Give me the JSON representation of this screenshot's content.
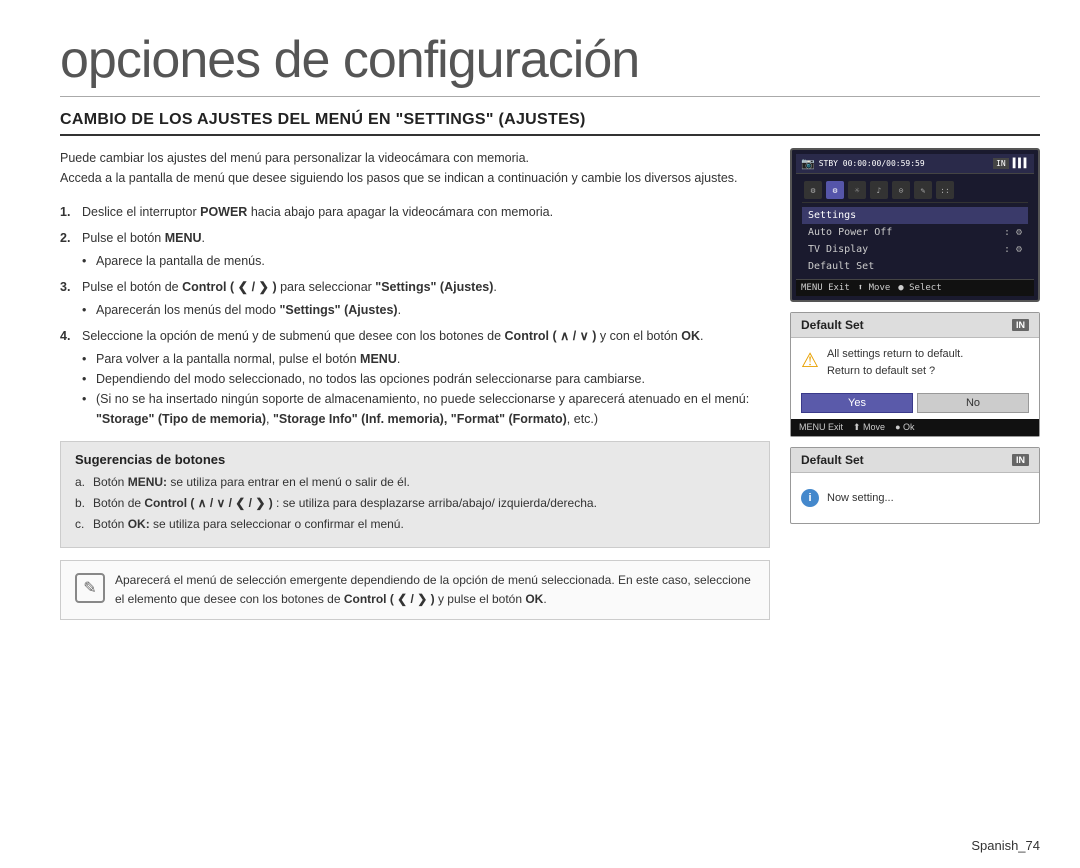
{
  "page": {
    "title": "opciones de configuración",
    "section_heading": "CAMBIO DE LOS AJUSTES DEL MENÚ EN \"SETTINGS\" (AJUSTES)",
    "intro": [
      "Puede cambiar los ajustes del menú para personalizar la videocámara con memoria.",
      "Acceda a la pantalla de menú que desee siguiendo los pasos que se indican a continuación y cambie los diversos ajustes."
    ],
    "steps": [
      {
        "num": "1.",
        "text": "Deslice el interruptor POWER hacia abajo para apagar la videocámara con memoria."
      },
      {
        "num": "2.",
        "text": "Pulse el botón MENU.",
        "sub": [
          "Aparece la pantalla de menús."
        ]
      },
      {
        "num": "3.",
        "text_pre": "Pulse el botón de Control ( ❮ / ❯ ) para seleccionar ",
        "text_bold": "\"Settings\" (Ajustes)",
        "text_post": ".",
        "sub": [
          "Aparecerán los menús del modo \"Settings\" (Ajustes)."
        ]
      },
      {
        "num": "4.",
        "text_pre": "Seleccione la opción de menú y de submenú que desee con los botones de Control ( ∧ / ∨ ) y con el botón ",
        "text_bold": "OK",
        "text_post": ".",
        "sub": [
          "Para volver a la pantalla normal, pulse el botón MENU.",
          "Dependiendo del modo seleccionado, no todos las opciones podrán seleccionarse para cambiarse.",
          "(Si no se ha insertado ningún soporte de almacenamiento, no puede seleccionarse y aparecerá atenuado en el menú: \"Storage\" (Tipo de memoria), \"Storage Info\" (Inf. memoria), \"Format\" (Formato), etc.)"
        ]
      }
    ],
    "tips_title": "Sugerencias de botones",
    "tips": [
      {
        "letter": "a.",
        "text_pre": "Botón ",
        "text_bold": "MENU:",
        "text_post": " se utiliza para entrar en el menú o salir de él."
      },
      {
        "letter": "b.",
        "text_pre": "Botón de ",
        "text_bold": "Control ( ∧ / ∨ / ❮ / ❯ )",
        "text_post": " : se utiliza para desplazarse arriba/abajo/ izquierda/derecha."
      },
      {
        "letter": "c.",
        "text_pre": "Botón ",
        "text_bold": "OK:",
        "text_post": " se utiliza para seleccionar o confirmar el menú."
      }
    ],
    "note_text": "Aparecerá el menú de selección emergente dependiendo de la opción de menú seleccionada. En este caso, seleccione el elemento que desee con los botones de Control ( ❮ / ❯ ) y pulse el botón OK.",
    "page_number": "Spanish_74"
  },
  "camera_screen": {
    "top_bar": "STBY 00:00:00/00:59:59",
    "badge": "IN",
    "menu_items": [
      {
        "label": "Settings",
        "selected": true
      },
      {
        "label": "Auto Power Off",
        "icon": "⚙"
      },
      {
        "label": "TV Display",
        "icon": "⚙"
      },
      {
        "label": "Default Set",
        "icon": ""
      }
    ],
    "bottom_bar": [
      "MENU Exit",
      "⬆ Move",
      "● Select"
    ]
  },
  "dialog1": {
    "title": "Default Set",
    "badge": "IN",
    "line1": "All settings return to default.",
    "line2": "Return to default set ?",
    "buttons": [
      "Yes",
      "No"
    ],
    "footer": [
      "MENU Exit",
      "⬆ Move",
      "● Ok"
    ]
  },
  "dialog2": {
    "title": "Default Set",
    "badge": "IN",
    "text": "Now setting..."
  }
}
